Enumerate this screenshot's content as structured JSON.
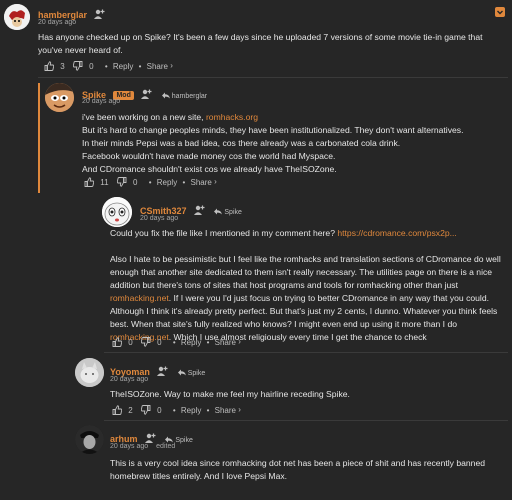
{
  "comments": [
    {
      "username": "hamberglar",
      "time": "20 days ago",
      "body": "Has anyone checked up on Spike? It's been a few days since he uploaded 7 versions of some movie tie-in game that you've never heard of.",
      "likes": "3",
      "dislikes": "0",
      "reply_label": "Reply",
      "share_label": "Share"
    },
    {
      "username": "Spike",
      "badge": "Mod",
      "reply_to": "hamberglar",
      "time": "20 days ago",
      "line1_prefix": "i've been working on a new site, ",
      "line1_link": "romhacks.org",
      "line2": "But it's hard to change peoples minds, they have been institutionalized. They don't want alternatives.",
      "line3": "In their minds Pepsi was a bad idea, cos there already was a carbonated cola drink.",
      "line4": "Facebook wouldn't have made money cos the world had Myspace.",
      "line5": "And CDromance shouldn't exist cos we already have TheISOZone.",
      "likes": "11",
      "dislikes": "0",
      "reply_label": "Reply",
      "share_label": "Share"
    },
    {
      "username": "CSmith327",
      "reply_to": "Spike",
      "time": "20 days ago",
      "p1_prefix": "Could you fix the file like I mentioned in my comment here? ",
      "p1_link": "https://cdromance.com/psx2p...",
      "p2_a": "Also I hate to be pessimistic but I feel like the romhacks and translation sections of CDromance do well enough that another site dedicated to them isn't really necessary. The utilities page on there is a nice addition but there's tons of sites that host programs and tools for romhacking other than just ",
      "p2_link1": "romhacking.net",
      "p2_b": ". If I were you I'd just focus on trying to better CDromance in any way that you could. Although I think it's already pretty perfect. But that's just my 2 cents, I dunno. Whatever you think feels best. When that site's fully realized who knows? I might even end up using it more than I do ",
      "p2_link2": "romhacking.net",
      "p2_c": ". Which I use almost religiously every time I get the chance to check",
      "likes": "0",
      "dislikes": "0",
      "reply_label": "Reply",
      "share_label": "Share"
    },
    {
      "username": "Yoyoman",
      "reply_to": "Spike",
      "time": "20 days ago",
      "body": "TheISOZone. Way to make me feel my hairline receding Spike.",
      "likes": "2",
      "dislikes": "0",
      "reply_label": "Reply",
      "share_label": "Share"
    },
    {
      "username": "arhum",
      "reply_to": "Spike",
      "time": "20 days ago",
      "edited": "edited",
      "body": "This is a very cool idea since romhacking dot net has been a piece of shit and has recently banned homebrew titles entirely. And I love Pepsi Max.",
      "likes": "2",
      "dislikes": "0",
      "reply_label": "Reply",
      "share_label": "Share"
    }
  ],
  "icons": {
    "follow": "add-user-icon",
    "reply_arrow": "reply-arrow-icon",
    "like": "thumbs-up-icon",
    "dislike": "thumbs-down-icon",
    "collapse": "chevron-down-icon"
  },
  "colors": {
    "background": "#262626",
    "accent": "#e0883c",
    "text": "#e6e6e6",
    "muted": "#a6a6a6"
  }
}
